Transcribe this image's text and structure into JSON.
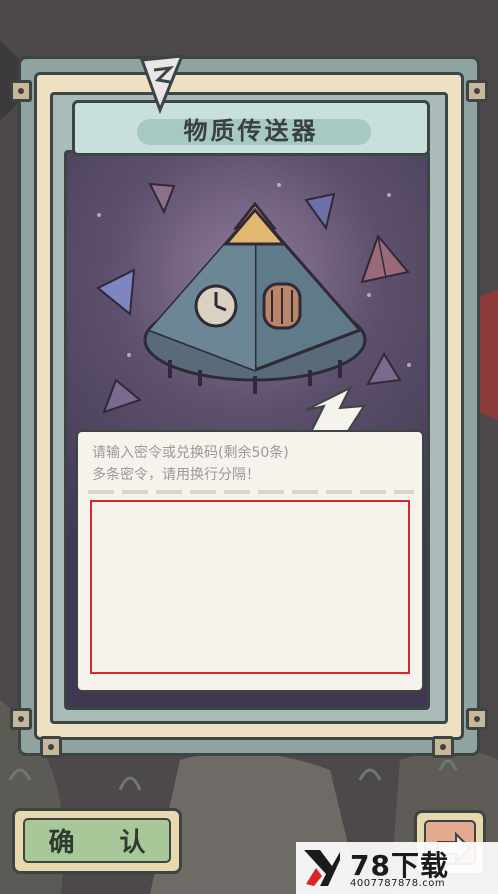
{
  "title": "物质传送器",
  "input": {
    "hint_line1": "请输入密令或兑换码(剩余50条)",
    "hint_line2": "多条密令，请用换行分隔！",
    "value": ""
  },
  "confirm_label": "确 认",
  "watermark": {
    "title": "78下载",
    "site": "4007787878.com"
  },
  "colors": {
    "panel_purple": "#4a4160",
    "banner_teal": "#c8dfdc",
    "confirm_green": "#a9c89a",
    "input_highlight": "#d8262b"
  }
}
